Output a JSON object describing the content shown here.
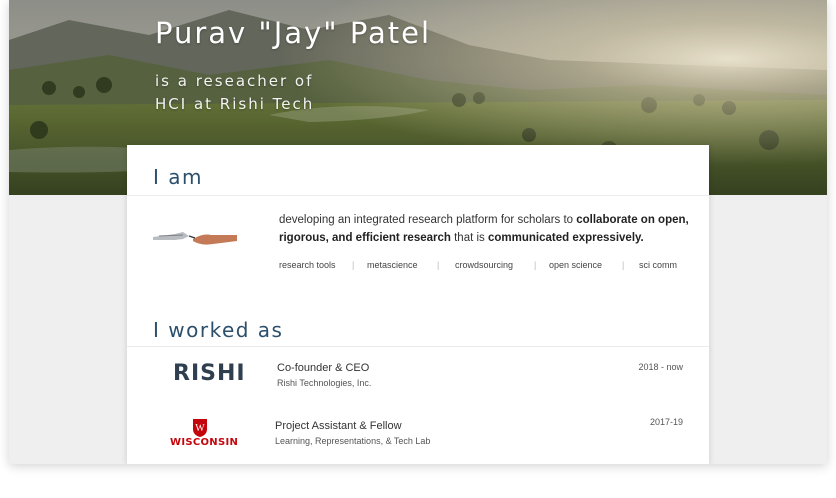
{
  "hero": {
    "name": "Purav \"Jay\" Patel",
    "subtitle_line1": "is a reseacher of",
    "subtitle_line2": "HCI at Rishi Tech"
  },
  "iam": {
    "heading": "I am",
    "text_parts": [
      {
        "text": "developing an integrated research platform for scholars to ",
        "bold": false
      },
      {
        "text": "collaborate on open, rigorous, and efficient research",
        "bold": true
      },
      {
        "text": " that is ",
        "bold": false
      },
      {
        "text": "communicated expressively.",
        "bold": true
      }
    ],
    "tags": [
      "research tools",
      "metascience",
      "crowdsourcing",
      "open science",
      "sci comm"
    ]
  },
  "worked": {
    "heading": "I worked as",
    "jobs": [
      {
        "logo": "RISHI",
        "title": "Co-founder & CEO",
        "org": "Rishi Technologies, Inc.",
        "dates": "2018 - now"
      },
      {
        "logo": "WISCONSIN",
        "title": "Project Assistant & Fellow",
        "org": "Learning, Representations, & Tech Lab",
        "dates": "2017-19"
      }
    ]
  },
  "colors": {
    "heading": "#2c4f6b",
    "wisconsin_red": "#c5050c"
  }
}
